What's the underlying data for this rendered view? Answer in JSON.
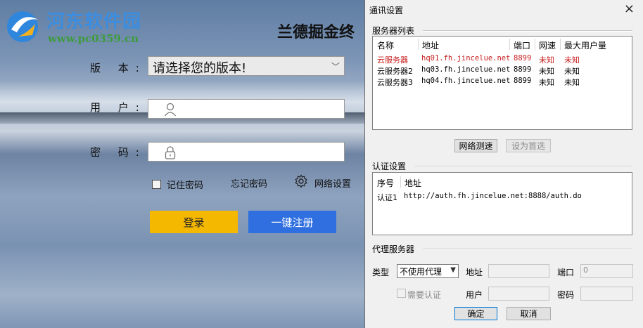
{
  "watermark": {
    "name": "河东软件园",
    "url": "www.pc0359.cn"
  },
  "login": {
    "app_title": "兰德掘金终",
    "version_label": "版 本:",
    "version_placeholder": "请选择您的版本!",
    "user_label": "用 户:",
    "password_label": "密 码:",
    "remember_label": "记住密码",
    "forgot_label": "忘记密码",
    "network_label": "网络设置",
    "login_button": "登录",
    "register_button": "一键注册",
    "colors": {
      "login": "#f5b800",
      "register": "#2f6fe0"
    }
  },
  "dialog": {
    "title": "通讯设置",
    "close": "×",
    "servers": {
      "section": "服务器列表",
      "headers": [
        "名称",
        "地址",
        "端口",
        "网速",
        "最大用户量"
      ],
      "rows": [
        {
          "name": "云服务器",
          "address": "hq01.fh.jincelue.net",
          "port": "8899",
          "speed": "未知",
          "max": "未知",
          "selected": true
        },
        {
          "name": "云服务器2",
          "address": "hq03.fh.jincelue.net",
          "port": "8899",
          "speed": "未知",
          "max": "未知"
        },
        {
          "name": "云服务器3",
          "address": "hq04.fh.jincelue.net",
          "port": "8899",
          "speed": "未知",
          "max": "未知"
        }
      ],
      "test_button": "网络测速",
      "prefer_button": "设为首选"
    },
    "auth": {
      "section": "认证设置",
      "headers": [
        "序号",
        "地址"
      ],
      "rows": [
        {
          "index": "认证1",
          "address": "http://auth.fh.jincelue.net:8888/auth.do"
        }
      ]
    },
    "proxy": {
      "section": "代理服务器",
      "type_label": "类型",
      "type_value": "不使用代理",
      "address_label": "地址",
      "port_label": "端口",
      "port_value": "0",
      "need_auth_label": "需要认证",
      "user_label": "用户",
      "password_label": "密码"
    },
    "ok_button": "确定",
    "cancel_button": "取消"
  }
}
